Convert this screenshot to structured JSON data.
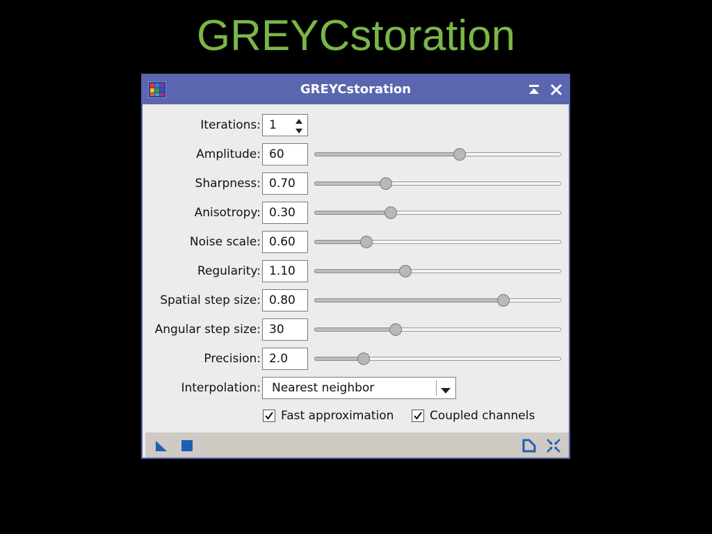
{
  "slide": {
    "title": "GREYCstoration"
  },
  "window": {
    "title": "GREYCstoration"
  },
  "params": {
    "iterations": {
      "label": "Iterations:",
      "value": "1"
    },
    "sliders": [
      {
        "name": "amplitude",
        "label": "Amplitude:",
        "value": "60",
        "position": 0.59
      },
      {
        "name": "sharpness",
        "label": "Sharpness:",
        "value": "0.70",
        "position": 0.29
      },
      {
        "name": "anisotropy",
        "label": "Anisotropy:",
        "value": "0.30",
        "position": 0.31
      },
      {
        "name": "noise-scale",
        "label": "Noise scale:",
        "value": "0.60",
        "position": 0.21
      },
      {
        "name": "regularity",
        "label": "Regularity:",
        "value": "1.10",
        "position": 0.37
      },
      {
        "name": "spatial-step-size",
        "label": "Spatial step size:",
        "value": "0.80",
        "position": 0.765
      },
      {
        "name": "angular-step-size",
        "label": "Angular step size:",
        "value": "30",
        "position": 0.33
      },
      {
        "name": "precision",
        "label": "Precision:",
        "value": "2.0",
        "position": 0.2
      }
    ],
    "interpolation": {
      "label": "Interpolation:",
      "value": "Nearest neighbor"
    },
    "checkboxes": {
      "fast": {
        "label": "Fast approximation",
        "checked": true
      },
      "coupled": {
        "label": "Coupled channels",
        "checked": true
      }
    }
  },
  "icons": {
    "app": "app-icon",
    "collapse": "collapse-icon",
    "close": "close-icon",
    "new_instance": "triangle-icon",
    "apply_global": "square-icon",
    "preview": "document-icon",
    "reset": "reset-icon"
  },
  "colors": {
    "accent": "#7ab648",
    "titlebar": "#5b66b0",
    "icon_blue": "#1e5fb3"
  }
}
